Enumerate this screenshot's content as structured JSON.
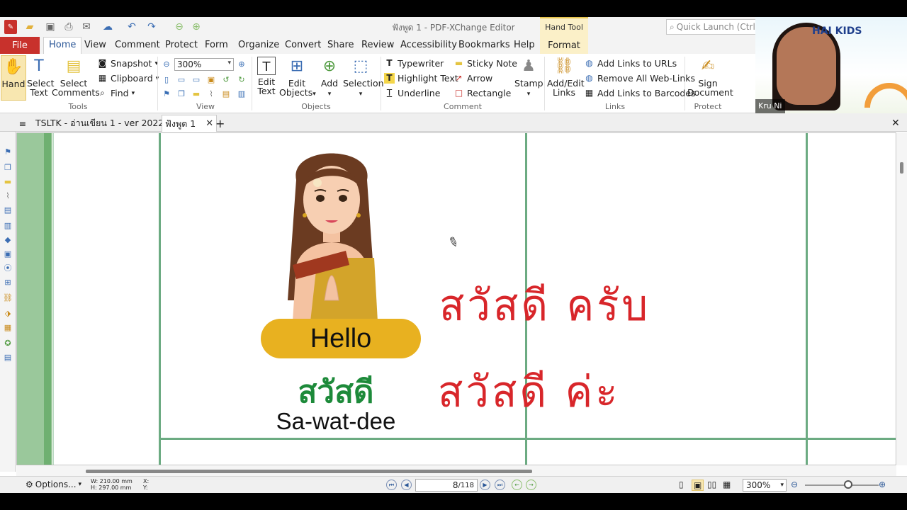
{
  "app": {
    "title": "ฟังพูด 1 - PDF-XChange Editor",
    "search_placeholder": "Quick Launch (Ctrl+.)"
  },
  "menu": {
    "file": "File",
    "tabs": [
      "Home",
      "View",
      "Comment",
      "Protect",
      "Form",
      "Organize",
      "Convert",
      "Share",
      "Review",
      "Accessibility",
      "Bookmarks",
      "Help"
    ],
    "active": "Home",
    "context_group": "Hand Tool",
    "context_tab": "Format"
  },
  "ribbon": {
    "tools": {
      "label": "Tools",
      "hand": "Hand",
      "select_text": [
        "Select",
        "Text"
      ],
      "select_comments": [
        "Select",
        "Comments"
      ],
      "snapshot": "Snapshot",
      "clipboard": "Clipboard",
      "find": "Find"
    },
    "view": {
      "label": "View",
      "zoom": "300%"
    },
    "objects": {
      "label": "Objects",
      "edit_text": [
        "Edit",
        "Text"
      ],
      "edit_objects": [
        "Edit",
        "Objects"
      ],
      "add": "Add",
      "selection": "Selection"
    },
    "comment": {
      "label": "Comment",
      "typewriter": "Typewriter",
      "highlight": "Highlight Text",
      "underline": "Underline",
      "sticky": "Sticky Note",
      "arrow": "Arrow",
      "rectangle": "Rectangle",
      "stamp": "Stamp"
    },
    "links": {
      "label": "Links",
      "add_edit": [
        "Add/Edit",
        "Links"
      ],
      "to_urls": "Add Links to URLs",
      "remove_all": "Remove All Web-Links",
      "to_barcodes": "Add Links to Barcodes"
    },
    "protect": {
      "label": "Protect",
      "sign": [
        "Sign",
        "Document"
      ]
    }
  },
  "video": {
    "brand": "HAI KIDS",
    "name": "Kru Ni"
  },
  "doc_tabs": [
    {
      "label": "TSLTK - อ่านเขียน 1 - ver 2022"
    },
    {
      "label": "ฟังพูด 1"
    }
  ],
  "page": {
    "hello": "Hello",
    "thai": "สวัสดี",
    "romanized": "Sa-wat-dee",
    "handwritten_1": "สวัสดี ครับ",
    "handwritten_2": "สวัสดี ค่ะ"
  },
  "status": {
    "options": "Options...",
    "width": "W: 210.00 mm",
    "height": "H: 297.00 mm",
    "x": "X:",
    "y": "Y:",
    "page_current": "8",
    "page_total": "/118",
    "zoom": "300%"
  },
  "colors": {
    "file_tab": "#c8312c",
    "hello_pill": "#e8b120",
    "thai_green": "#1d8a3a",
    "ink_red": "#d8262a",
    "grid_green": "#6cab82"
  }
}
